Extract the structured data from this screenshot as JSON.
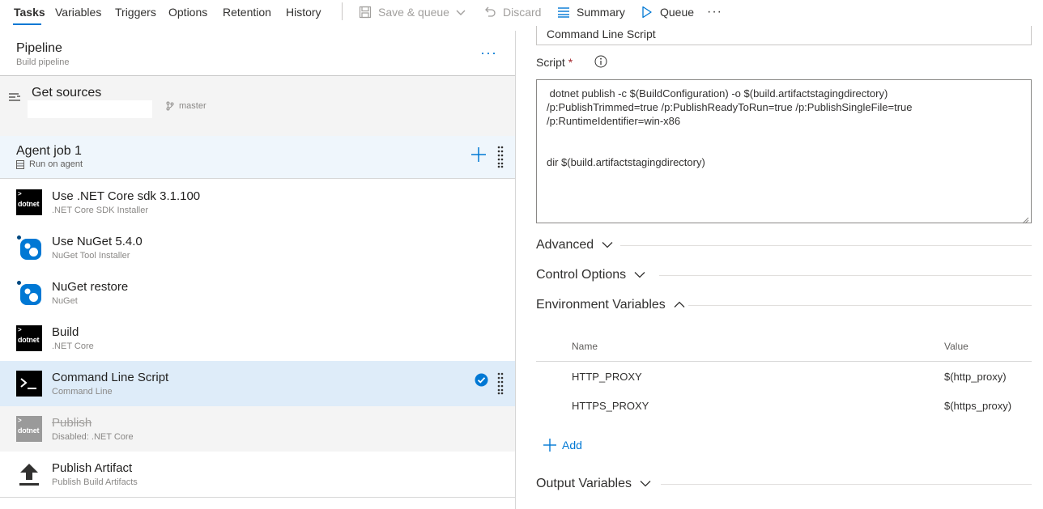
{
  "toolbar": {
    "tabs": [
      "Tasks",
      "Variables",
      "Triggers",
      "Options",
      "Retention",
      "History"
    ],
    "save_queue": "Save & queue",
    "discard": "Discard",
    "summary": "Summary",
    "queue": "Queue",
    "more": "···"
  },
  "pipeline": {
    "title": "Pipeline",
    "subtitle": "Build pipeline",
    "menu": "···"
  },
  "get_sources": {
    "title": "Get sources",
    "branch": "master"
  },
  "agent_job": {
    "title": "Agent job 1",
    "subtitle": "Run on agent"
  },
  "tasks": [
    {
      "name": "Use .NET Core sdk 3.1.100",
      "sub": ".NET Core SDK Installer",
      "icon": "dotnet-icon",
      "icon_text": "dotnet"
    },
    {
      "name": "Use NuGet 5.4.0",
      "sub": "NuGet Tool Installer",
      "icon": "nuget-icon"
    },
    {
      "name": "NuGet restore",
      "sub": "NuGet",
      "icon": "nuget-icon"
    },
    {
      "name": "Build",
      "sub": ".NET Core",
      "icon": "dotnet-icon",
      "icon_text": "dotnet"
    },
    {
      "name": "Command Line Script",
      "sub": "Command Line",
      "icon": "terminal-icon",
      "state": "selected"
    },
    {
      "name": "Publish",
      "sub": "Disabled: .NET Core",
      "icon": "dotnet-icon",
      "icon_text": "dotnet",
      "state": "disabled"
    },
    {
      "name": "Publish Artifact",
      "sub": "Publish Build Artifacts",
      "icon": "upload-icon"
    }
  ],
  "details": {
    "display_name": "Command Line Script",
    "script_label": "Script",
    "required_mark": "*",
    "script_lines": [
      " dotnet publish -c $(BuildConfiguration) -o $(build.artifactstagingdirectory)",
      "/p:PublishTrimmed=true /p:PublishReadyToRun=true /p:PublishSingleFile=true",
      "/p:RuntimeIdentifier=win-x86",
      "",
      "",
      "dir $(build.artifactstagingdirectory)"
    ],
    "sections": {
      "advanced": "Advanced",
      "control_options": "Control Options",
      "environment_variables": "Environment Variables",
      "output_variables": "Output Variables"
    },
    "env_table": {
      "headers": {
        "name": "Name",
        "value": "Value"
      },
      "rows": [
        {
          "name": "HTTP_PROXY",
          "value": "$(http_proxy)"
        },
        {
          "name": "HTTPS_PROXY",
          "value": "$(https_proxy)"
        }
      ],
      "add_label": "Add"
    }
  },
  "colors": {
    "accent": "#0078d4",
    "selected_row": "#deecf9",
    "agent_job_bg": "#eff6fc"
  }
}
